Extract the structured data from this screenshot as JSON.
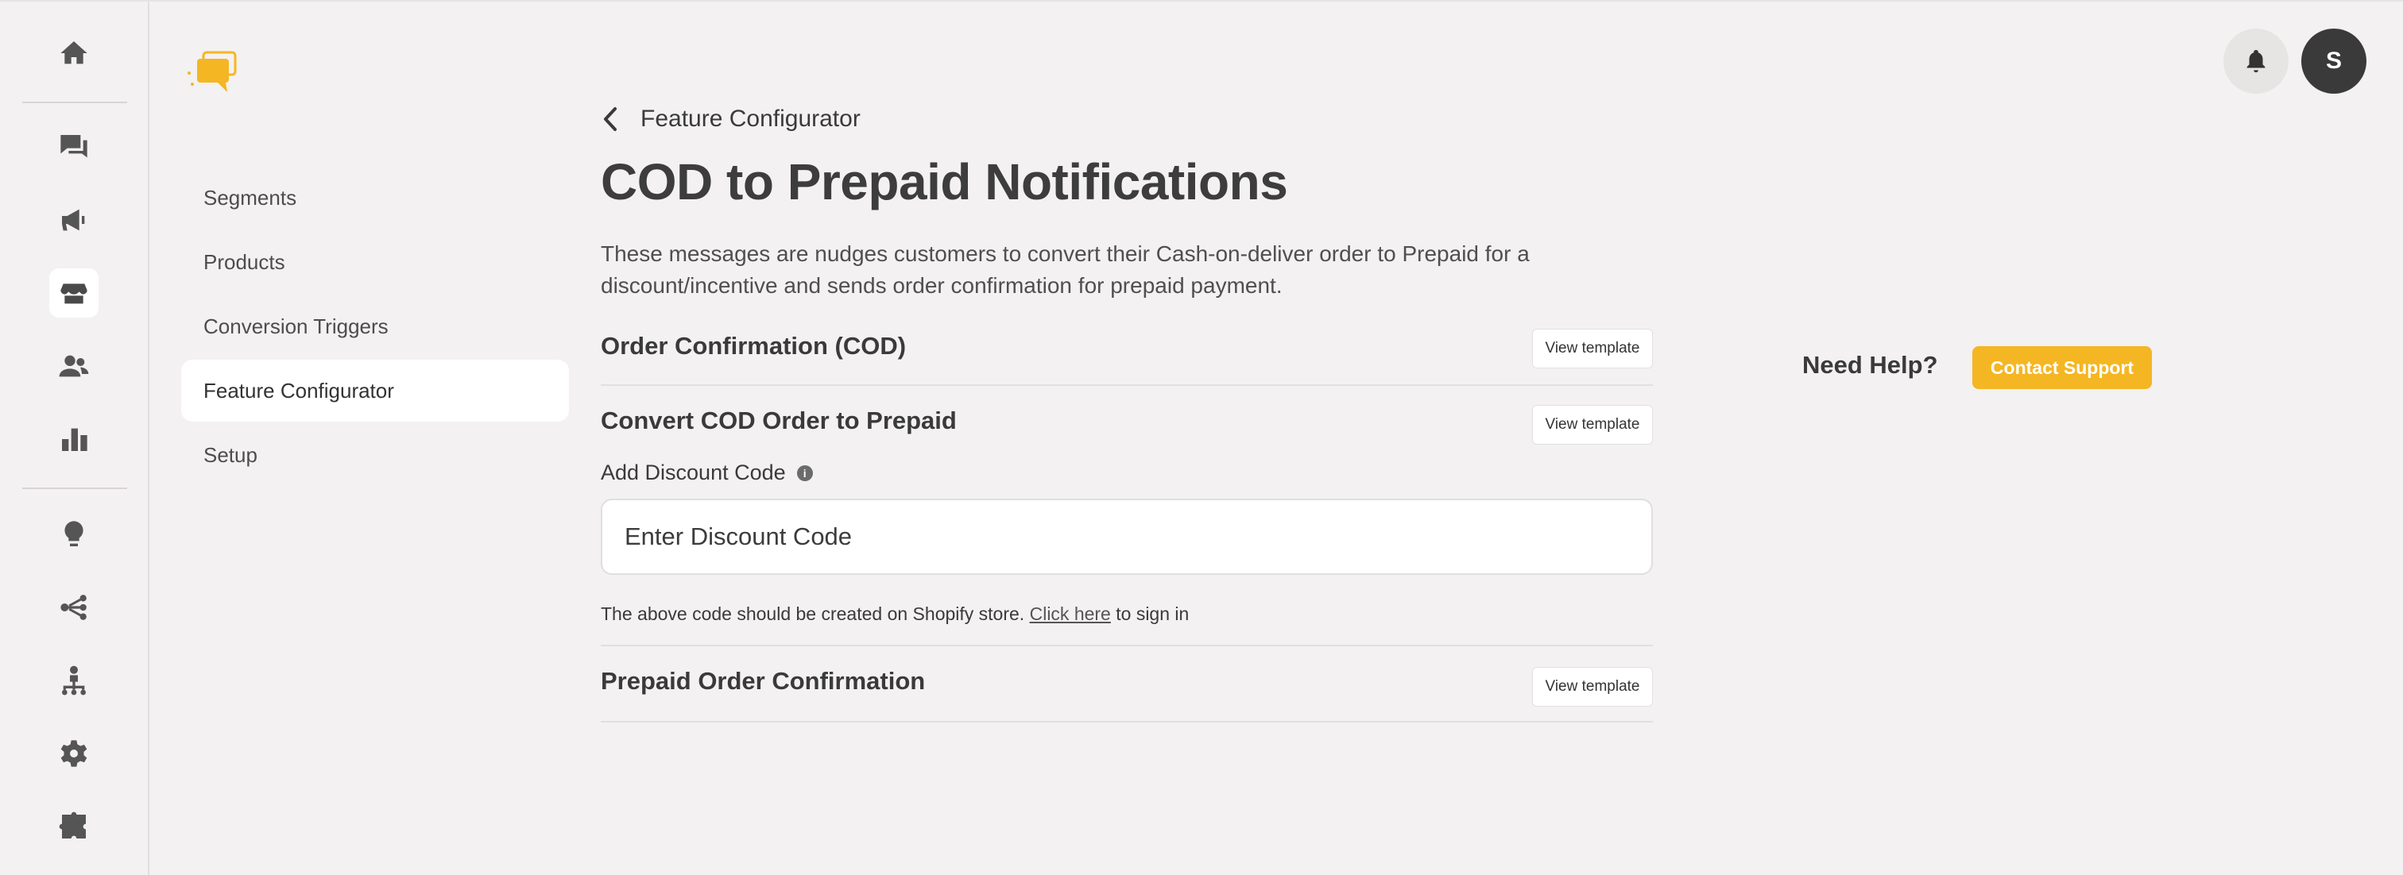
{
  "rail": {
    "icons": [
      {
        "name": "home-icon"
      },
      {
        "name": "chat-icon"
      },
      {
        "name": "megaphone-icon"
      },
      {
        "name": "store-icon",
        "active": true
      },
      {
        "name": "users-icon"
      },
      {
        "name": "bar-chart-icon"
      },
      {
        "name": "lightbulb-icon"
      },
      {
        "name": "flow-icon"
      },
      {
        "name": "hierarchy-icon"
      },
      {
        "name": "gear-icon"
      },
      {
        "name": "puzzle-icon"
      }
    ]
  },
  "subnav": {
    "items": [
      {
        "label": "Segments"
      },
      {
        "label": "Products"
      },
      {
        "label": "Conversion Triggers"
      },
      {
        "label": "Feature Configurator",
        "active": true
      },
      {
        "label": "Setup"
      }
    ]
  },
  "breadcrumb": {
    "label": "Feature Configurator"
  },
  "page": {
    "title": "COD to Prepaid Notifications",
    "description": "These messages are nudges customers to convert their Cash-on-deliver order to Prepaid for a discount/incentive and sends order confirmation for prepaid payment."
  },
  "sections": {
    "cod_confirmation": {
      "title": "Order Confirmation (COD)",
      "button": "View template"
    },
    "convert": {
      "title": "Convert COD Order to Prepaid",
      "button": "View template"
    },
    "prepaid": {
      "title": "Prepaid Order Confirmation",
      "button": "View template"
    }
  },
  "discount": {
    "label": "Add Discount Code",
    "placeholder": "Enter Discount Code",
    "value": "",
    "help_before": "The above code should be created on Shopify store. ",
    "help_link": "Click here",
    "help_after": " to sign in"
  },
  "help": {
    "title": "Need Help?",
    "button": "Contact Support"
  },
  "user": {
    "initial": "S"
  },
  "colors": {
    "accent": "#f5b623",
    "background": "#f3f1f1",
    "avatar": "#3a3a3a"
  }
}
